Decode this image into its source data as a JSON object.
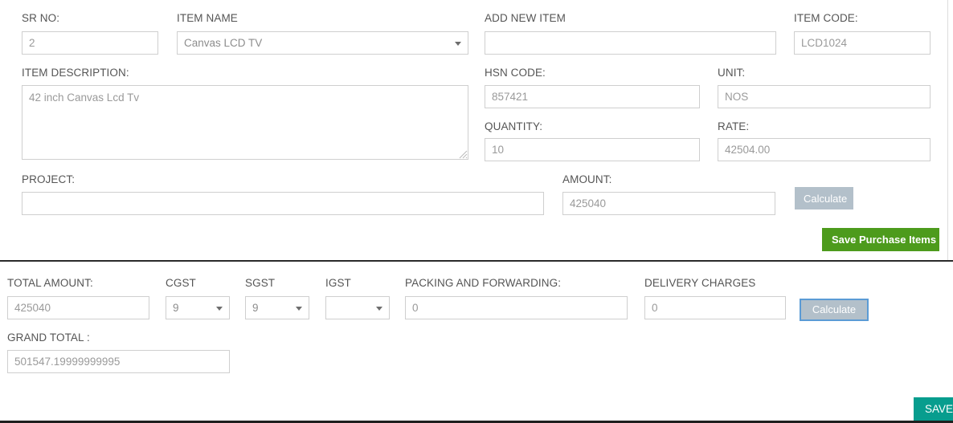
{
  "form": {
    "item_section": {
      "sr_no": {
        "label": "SR NO:",
        "value": "2"
      },
      "item_name": {
        "label": "ITEM NAME",
        "value": "Canvas LCD TV"
      },
      "add_new_item": {
        "label": "ADD NEW ITEM",
        "value": ""
      },
      "item_code": {
        "label": "ITEM CODE:",
        "value": "LCD1024"
      },
      "item_description": {
        "label": "ITEM DESCRIPTION:",
        "value": "42 inch Canvas Lcd Tv"
      },
      "hsn_code": {
        "label": "HSN CODE:",
        "value": "857421"
      },
      "unit": {
        "label": "UNIT:",
        "value": "NOS"
      },
      "quantity": {
        "label": "QUANTITY:",
        "value": "10"
      },
      "rate": {
        "label": "RATE:",
        "value": "42504.00"
      },
      "project": {
        "label": "PROJECT:",
        "value": ""
      },
      "amount": {
        "label": "AMOUNT:",
        "value": "425040"
      },
      "calculate_label": "Calculate",
      "save_purchase_items_label": "Save Purchase Items"
    },
    "totals_section": {
      "total_amount": {
        "label": "TOTAL AMOUNT:",
        "value": "425040"
      },
      "cgst": {
        "label": "CGST",
        "value": "9"
      },
      "sgst": {
        "label": "SGST",
        "value": "9"
      },
      "igst": {
        "label": "IGST",
        "value": ""
      },
      "packing_and_forwarding": {
        "label": "PACKING AND FORWARDING:",
        "value": "0"
      },
      "delivery_charges": {
        "label": "DELIVERY CHARGES",
        "value": "0"
      },
      "grand_total": {
        "label": "GRAND TOTAL :",
        "value": "501547.19999999995"
      },
      "calculate_label": "Calculate"
    },
    "footer": {
      "save_label": "SAVE"
    }
  },
  "colors": {
    "green_button": "#4d9b1c",
    "teal_button": "#079d8e",
    "gray_button": "#b3c0ca",
    "focus_border": "#5b9bd5",
    "field_border": "#cfcfcf",
    "label_text": "#555555",
    "value_text": "#9a9a9a"
  }
}
